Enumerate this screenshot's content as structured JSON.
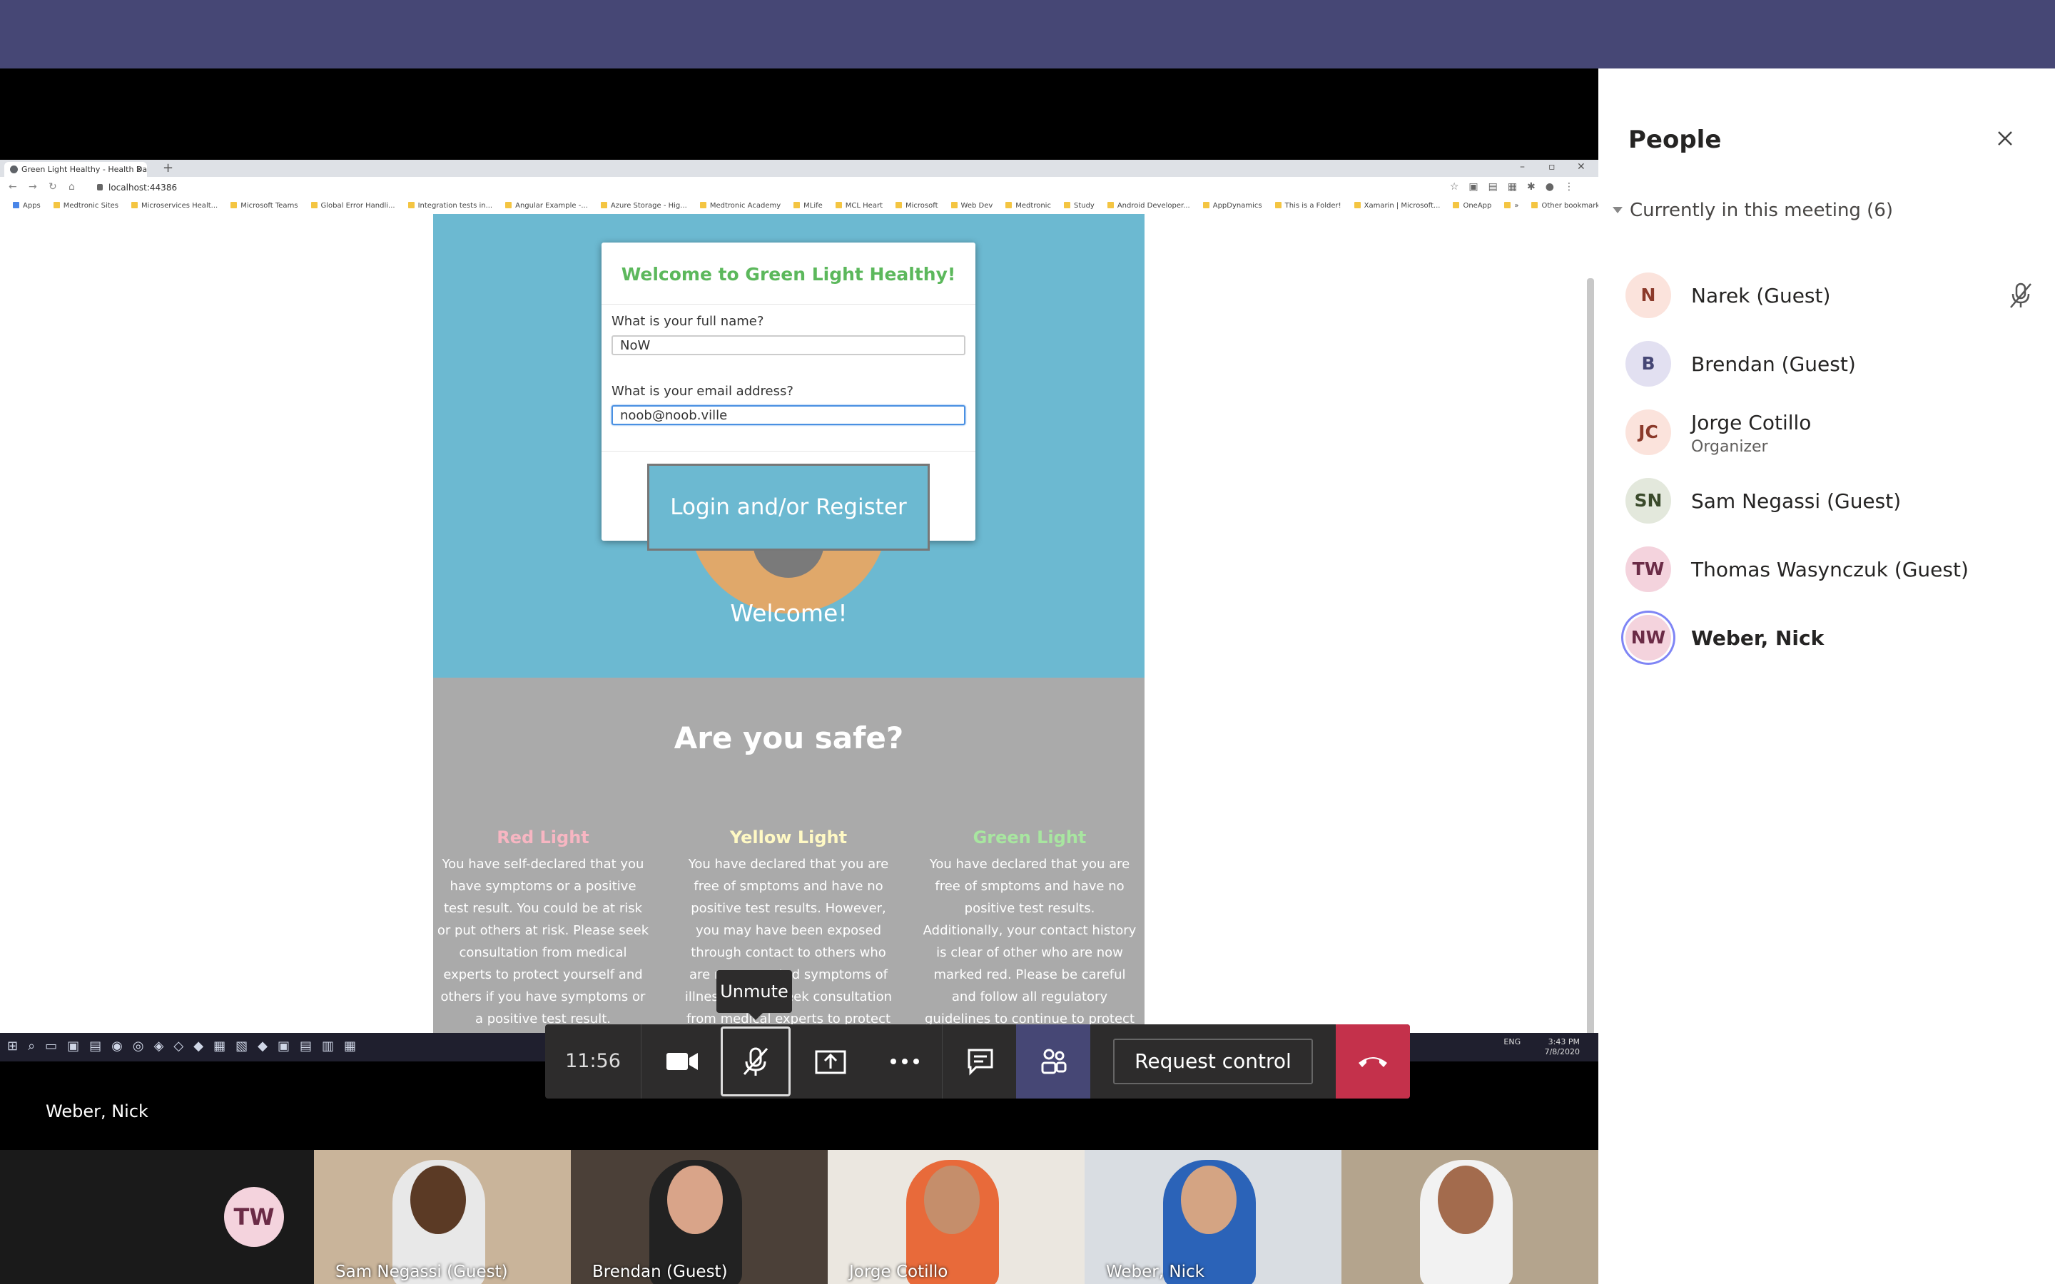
{
  "browser": {
    "tab_title": "Green Light Healthy - Health Da",
    "tab_close": "×",
    "new_tab": "+",
    "window_controls": [
      "–",
      "▫",
      "✕"
    ],
    "url": "localhost:44386",
    "bookmarks": [
      "Apps",
      "Medtronic Sites",
      "Microservices Healt...",
      "Microsoft Teams",
      "Global Error Handli...",
      "Integration tests in...",
      "Angular Example -...",
      "Azure Storage - Hig...",
      "Medtronic Academy",
      "MLife",
      "MCL Heart",
      "Microsoft",
      "Web Dev",
      "Medtronic",
      "Study",
      "Android Developer...",
      "AppDynamics",
      "This is a Folder!",
      "Xamarin | Microsoft...",
      "OneApp",
      "»",
      "Other bookmarks"
    ]
  },
  "site": {
    "welcome": "Welcome!",
    "safe_title": "Are you safe?",
    "columns": [
      {
        "title": "Red Light",
        "color": "#f7b6c2",
        "text": "You have self-declared that you have symptoms or a positive test result. You could be at risk or put others at risk. Please seek consultation from medical experts to protect yourself and others if you have symptoms or a positive test result."
      },
      {
        "title": "Yellow Light",
        "color": "#fff9c4",
        "text": "You have declared that you are free of smptoms and have no positive test results. However, you may have been exposed through contact to others who are now reported symptoms of illness. Please seek consultation from medical experts to protect yourself"
      },
      {
        "title": "Green Light",
        "color": "#a8e6a0",
        "text": "You have declared that you are free of smptoms and have no positive test results. Additionally, your contact history is clear of other who are now marked red. Please be careful and follow all regulatory guidelines to continue to protect yourself and others."
      }
    ]
  },
  "modal": {
    "title": "Welcome to Green Light Healthy!",
    "name_label": "What is your full name?",
    "name_value": "NoW",
    "email_label": "What is your email address?",
    "email_value": "noob@noob.ville",
    "login_button": "Login and/or Register"
  },
  "taskbar": {
    "time": "3:43 PM",
    "date": "7/8/2020",
    "lang": "ENG"
  },
  "meeting": {
    "timer": "11:56",
    "unmute_tooltip": "Unmute",
    "request_control": "Request control",
    "presenter_name": "Weber, Nick",
    "colors": {
      "hangup": "#c4314b",
      "active": "#464775",
      "brand": "#464775"
    }
  },
  "video_strip": {
    "tw_initials": "TW",
    "tiles": [
      {
        "name": "Sam Negassi (Guest)",
        "shirt": "#e8e8e8",
        "bg": "#c9b49a",
        "skin": "#5b3a25"
      },
      {
        "name": "Brendan (Guest)",
        "shirt": "#222222",
        "bg": "#4b4038",
        "skin": "#d9a489"
      },
      {
        "name": "Jorge Cotillo",
        "shirt": "#e86a3a",
        "bg": "#ebe7e0",
        "skin": "#c58e6b"
      },
      {
        "name": "Weber, Nick",
        "shirt": "#2b63b8",
        "bg": "#d9dde2",
        "skin": "#d4a483"
      },
      {
        "name": "",
        "shirt": "#f2f2f2",
        "bg": "#b4a48d",
        "skin": "#a36b4d"
      }
    ]
  },
  "people_panel": {
    "title": "People",
    "section_label": "Currently in this meeting (6)",
    "participants": [
      {
        "initials": "N",
        "name": "Narek (Guest)",
        "role": "",
        "av_bg": "#fbe3dc",
        "av_fg": "#8b3a2b",
        "muted": true
      },
      {
        "initials": "B",
        "name": "Brendan (Guest)",
        "role": "",
        "av_bg": "#e2e0f1",
        "av_fg": "#464775",
        "muted": false
      },
      {
        "initials": "JC",
        "name": "Jorge Cotillo",
        "role": "Organizer",
        "av_bg": "#fbe3dc",
        "av_fg": "#8b3a2b",
        "muted": false
      },
      {
        "initials": "SN",
        "name": "Sam Negassi (Guest)",
        "role": "",
        "av_bg": "#e3e8dc",
        "av_fg": "#3a4a2b",
        "muted": false
      },
      {
        "initials": "TW",
        "name": "Thomas Wasynczuk (Guest)",
        "role": "",
        "av_bg": "#f4d3dd",
        "av_fg": "#6b2b46",
        "muted": false
      },
      {
        "initials": "NW",
        "name": "Weber, Nick",
        "role": "",
        "av_bg": "#f4d3dd",
        "av_fg": "#6b2b46",
        "muted": false
      }
    ]
  }
}
